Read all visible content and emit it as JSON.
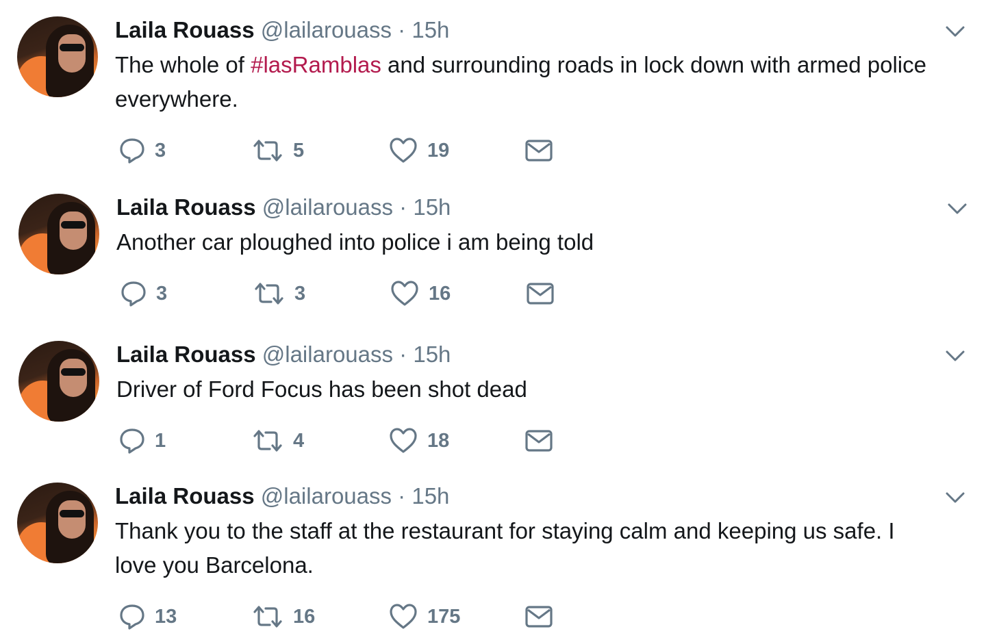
{
  "tweets": [
    {
      "name": "Laila Rouass",
      "handle": "@lailarouass",
      "separator": "·",
      "time": "15h",
      "text_before": "The whole of ",
      "hashtag": "#lasRamblas",
      "text_after": " and surrounding roads in lock down with armed police everywhere.",
      "replies": "3",
      "retweets": "5",
      "likes": "19"
    },
    {
      "name": "Laila Rouass",
      "handle": "@lailarouass",
      "separator": "·",
      "time": "15h",
      "text_before": "Another car ploughed into police i am being told",
      "hashtag": "",
      "text_after": "",
      "replies": "3",
      "retweets": "3",
      "likes": "16"
    },
    {
      "name": "Laila Rouass",
      "handle": "@lailarouass",
      "separator": "·",
      "time": "15h",
      "text_before": "Driver of Ford Focus has been shot dead",
      "hashtag": "",
      "text_after": "",
      "replies": "1",
      "retweets": "4",
      "likes": "18"
    },
    {
      "name": "Laila Rouass",
      "handle": "@lailarouass",
      "separator": "·",
      "time": "15h",
      "text_before": "Thank you to the staff at the restaurant for staying calm and keeping us safe. I love you Barcelona.",
      "hashtag": "",
      "text_after": "",
      "replies": "13",
      "retweets": "16",
      "likes": "175"
    }
  ],
  "icons": {
    "reply": "reply-icon",
    "retweet": "retweet-icon",
    "like": "heart-icon",
    "message": "envelope-icon",
    "menu": "chevron-down-icon",
    "avatar": "avatar"
  },
  "colors": {
    "text": "#14171a",
    "muted": "#657786",
    "hashtag": "#b31b4e"
  }
}
